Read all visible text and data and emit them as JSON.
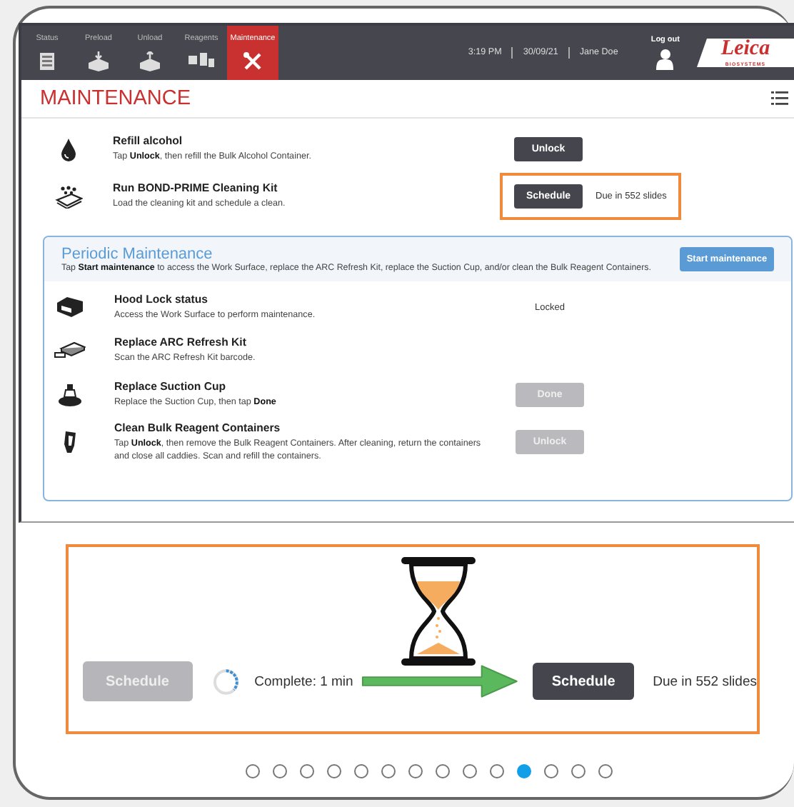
{
  "header": {
    "tabs": [
      {
        "label": "Status",
        "selected": false
      },
      {
        "label": "Preload",
        "selected": false
      },
      {
        "label": "Unload",
        "selected": false
      },
      {
        "label": "Reagents",
        "selected": false
      },
      {
        "label": "Maintenance",
        "selected": true
      }
    ],
    "time": "3:19 PM",
    "date": "30/09/21",
    "user": "Jane Doe",
    "logout": "Log out",
    "logo": {
      "name": "Leica",
      "subtitle": "BIOSYSTEMS"
    }
  },
  "page_title": "MAINTENANCE",
  "tasks": [
    {
      "title": "Refill alcohol",
      "description": "Tap **Unlock**, then refill the Bulk Alcohol Container.",
      "button": {
        "label": "Unlock",
        "disabled": false
      },
      "highlighted": false
    },
    {
      "title": "Run BOND-PRIME Cleaning Kit",
      "description": "Load the cleaning kit and schedule a clean.",
      "button": {
        "label": "Schedule",
        "disabled": false
      },
      "note": "Due in 552 slides",
      "highlighted": true
    }
  ],
  "periodic": {
    "title": "Periodic Maintenance",
    "description": "Tap **Start maintenance** to access the Work Surface, replace the ARC Refresh Kit, replace the Suction Cup, and/or clean the Bulk Reagent Containers.",
    "button": "Start maintenance",
    "tasks": [
      {
        "title": "Hood Lock status",
        "description": "Access the Work Surface to perform maintenance.",
        "status": "Locked"
      },
      {
        "title": "Replace ARC Refresh Kit",
        "description": "Scan the ARC Refresh Kit barcode."
      },
      {
        "title": "Replace Suction Cup",
        "description": "Replace the Suction Cup, then tap **Done**",
        "button": {
          "label": "Done",
          "disabled": true
        }
      },
      {
        "title": "Clean Bulk Reagent Containers",
        "description": "Tap **Unlock**, then remove the Bulk Reagent Containers. After cleaning, return the containers and close all caddies. Scan and refill the containers.",
        "button": {
          "label": "Unlock",
          "disabled": true
        }
      }
    ]
  },
  "callout": {
    "before_button": {
      "label": "Schedule",
      "disabled": true
    },
    "progress": "Complete: 1 min",
    "after_button": {
      "label": "Schedule",
      "disabled": false
    },
    "note": "Due in 552 slides"
  },
  "pager": {
    "dots": [
      {
        "selected": false
      },
      {
        "selected": false
      },
      {
        "selected": false
      },
      {
        "selected": false
      },
      {
        "selected": false
      },
      {
        "selected": false
      },
      {
        "selected": false
      },
      {
        "selected": false
      },
      {
        "selected": false
      },
      {
        "selected": false
      },
      {
        "selected": true
      },
      {
        "selected": false
      },
      {
        "selected": false
      },
      {
        "selected": false
      }
    ]
  }
}
